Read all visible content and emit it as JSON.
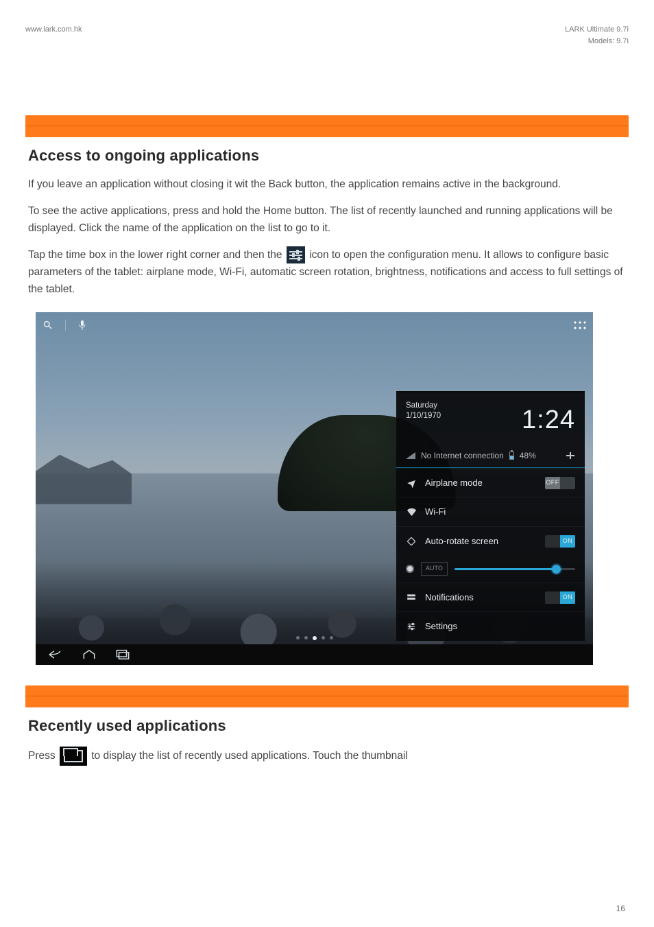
{
  "page_header": {
    "left": "www.lark.com.hk",
    "right_line1": "LARK Ultimate 9.7i",
    "right_line2": "Models: 9.7i"
  },
  "section1": {
    "title": "Access to ongoing applications",
    "para1": "If you leave an application without closing it wit the Back button, the application remains active in the background.",
    "para2": "To see the active applications, press and hold the Home button. The list of recently launched and running applications will be displayed. Click the name of the application on the list to go to it.",
    "para3_a": "Tap the time box in the lower right corner and then the",
    "para3_b": "icon to open the configuration menu. It allows to configure basic parameters of the tablet: airplane mode, Wi-Fi, automatic screen rotation, brightness, notifications and access to full settings of the tablet."
  },
  "screenshot": {
    "top": {
      "search_icon": "search-icon",
      "mic_icon": "mic-icon",
      "apps_icon": "apps-icon"
    },
    "panel": {
      "day": "Saturday",
      "date": "1/10/1970",
      "clock": "1:24",
      "status_text": "No Internet connection",
      "battery_pct": "48%",
      "rows": {
        "airplane": {
          "label": "Airplane mode",
          "state": "OFF"
        },
        "wifi": {
          "label": "Wi-Fi"
        },
        "rotate": {
          "label": "Auto-rotate screen",
          "state": "ON"
        },
        "brightness": {
          "auto_label": "AUTO"
        },
        "notifications": {
          "label": "Notifications",
          "state": "ON"
        },
        "settings": {
          "label": "Settings"
        }
      }
    },
    "nav": {
      "back": "back-icon",
      "home": "home-icon",
      "recent": "recent-icon"
    }
  },
  "section2": {
    "title": "Recently used applications",
    "para_a": "Press",
    "para_b": "to display the list of recently used applications. Touch the thumbnail"
  },
  "page_number": "16"
}
